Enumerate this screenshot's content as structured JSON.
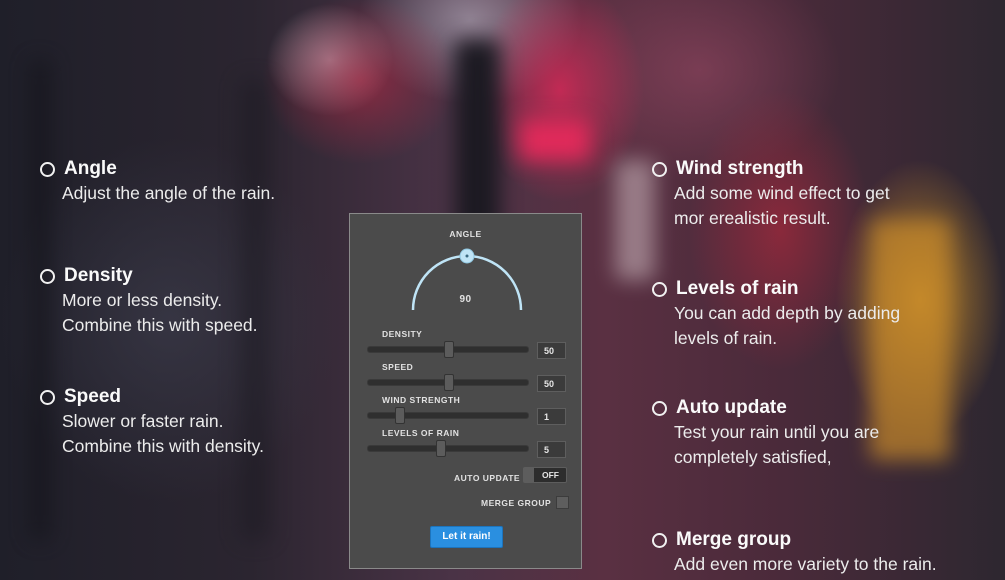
{
  "features_left": [
    {
      "title": "Angle",
      "desc": [
        "Adjust the angle of the rain."
      ]
    },
    {
      "title": "Density",
      "desc": [
        "More or less density.",
        "Combine this with speed."
      ]
    },
    {
      "title": "Speed",
      "desc": [
        "Slower or faster rain.",
        "Combine this with density."
      ]
    }
  ],
  "features_right": [
    {
      "title": "Wind strength",
      "desc": [
        "Add some wind effect to get",
        "mor erealistic result."
      ]
    },
    {
      "title": "Levels of rain",
      "desc": [
        "You can add depth by adding",
        "levels of rain."
      ]
    },
    {
      "title": "Auto update",
      "desc": [
        "Test your rain until you are",
        "completely satisfied,"
      ]
    },
    {
      "title": "Merge group",
      "desc": [
        "Add even more variety to the rain."
      ]
    }
  ],
  "panel": {
    "angle_label": "ANGLE",
    "angle_value": "90",
    "sliders": [
      {
        "label": "DENSITY",
        "value": "50",
        "level": 0.5
      },
      {
        "label": "SPEED",
        "value": "50",
        "level": 0.5
      },
      {
        "label": "WIND STRENGTH",
        "value": "1",
        "level": 0.18
      },
      {
        "label": "LEVELS OF RAIN",
        "value": "5",
        "level": 0.45
      }
    ],
    "auto_update_label": "AUTO UPDATE",
    "auto_update_state": "OFF",
    "merge_group_label": "MERGE GROUP",
    "button_label": "Let it rain!"
  },
  "colors": {
    "accent": "#2a8fe0",
    "dial": "#bfe4f6",
    "panel_bg": "#4b4b4b"
  }
}
